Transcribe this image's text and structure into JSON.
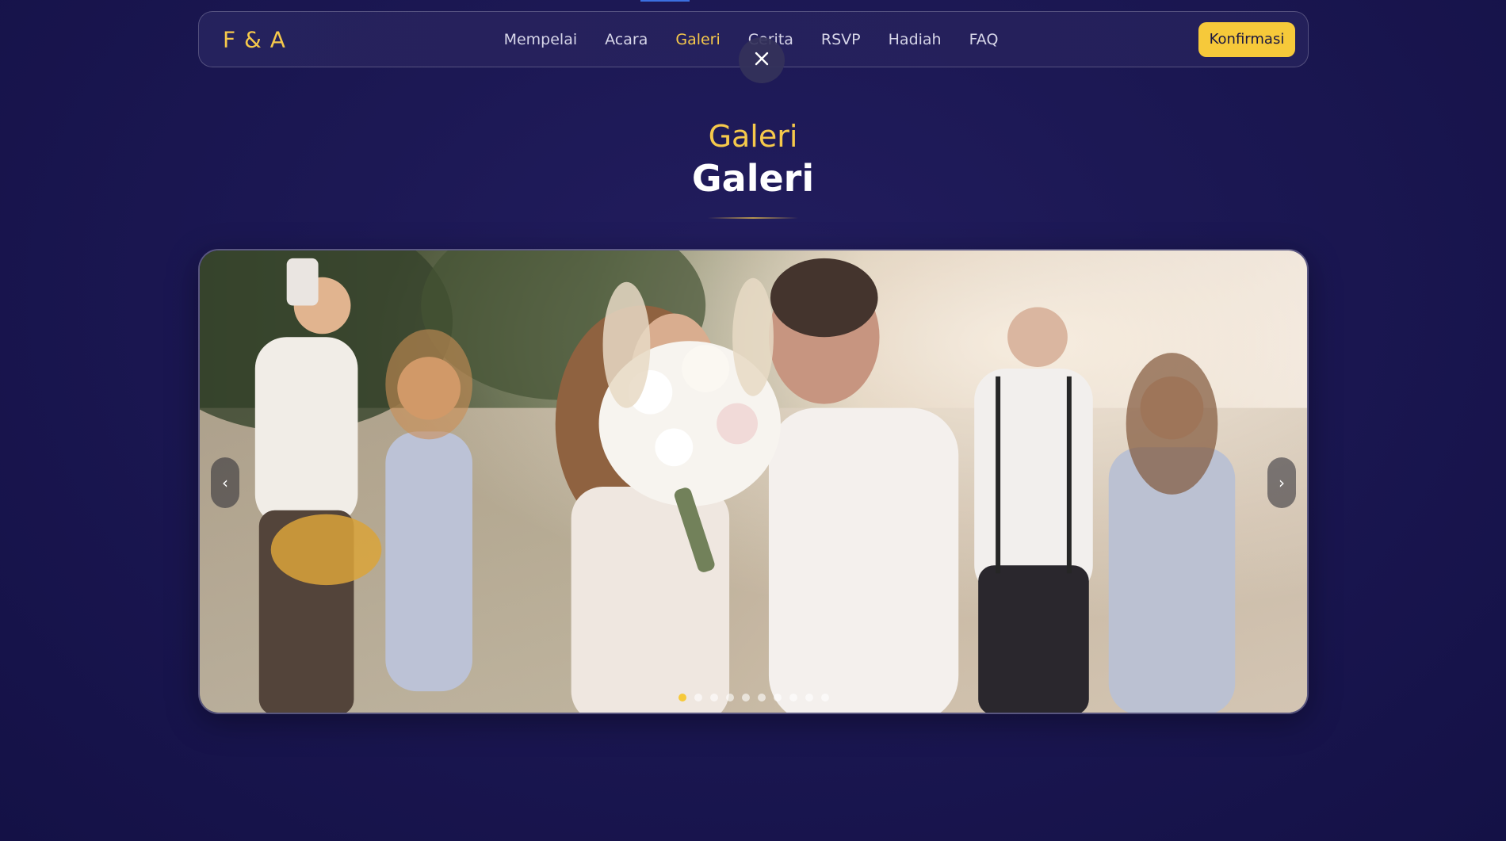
{
  "nav": {
    "brand": "F & A",
    "links": [
      {
        "label": "Mempelai",
        "active": false
      },
      {
        "label": "Acara",
        "active": false
      },
      {
        "label": "Galeri",
        "active": true
      },
      {
        "label": "Cerita",
        "active": false
      },
      {
        "label": "RSVP",
        "active": false
      },
      {
        "label": "Hadiah",
        "active": false
      },
      {
        "label": "FAQ",
        "active": false
      }
    ],
    "cta_label": "Konfirmasi",
    "close_icon": "close-icon"
  },
  "section": {
    "kicker": "Galeri",
    "title": "Galeri"
  },
  "carousel": {
    "prev_label": "‹",
    "next_label": "›",
    "slide_count": 10,
    "active_index": 0,
    "image_subject": "wedding couple with bouquet and guests"
  },
  "colors": {
    "accent": "#f6c93a",
    "background": "#1c1854",
    "text": "#ffffff"
  }
}
